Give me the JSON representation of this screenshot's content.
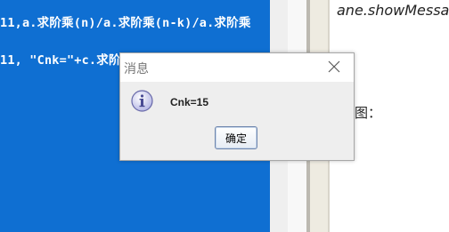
{
  "editor": {
    "line1": "11,a.求阶乘(n)/a.求阶乘(n-k)/a.求阶乘",
    "line2": "11, \"Cnk=\"+c.求阶乘"
  },
  "document": {
    "text_top": "ane.showMessa",
    "text_mid": "图："
  },
  "dialog": {
    "title": "消息",
    "message": "Cnk=15",
    "ok_label": "确定",
    "icon": "info-icon",
    "close_icon": "close-icon"
  },
  "colors": {
    "editor_bg": "#0f6fd2",
    "dialog_bg": "#eeeeee",
    "button_border": "#6f86ad"
  }
}
